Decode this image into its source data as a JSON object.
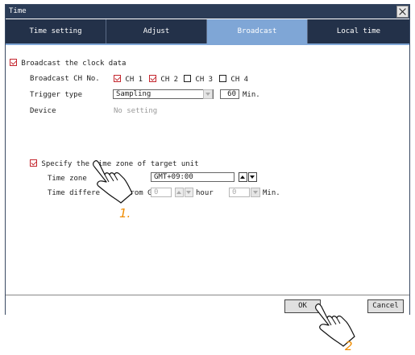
{
  "window": {
    "title": "Time"
  },
  "tabs": [
    {
      "label": "Time setting"
    },
    {
      "label": "Adjust"
    },
    {
      "label": "Broadcast"
    },
    {
      "label": "Local time"
    }
  ],
  "broadcast": {
    "checkbox_label": "Broadcast the clock data",
    "checked": true,
    "ch_label": "Broadcast CH No.",
    "channels": [
      {
        "label": "CH 1",
        "checked": true
      },
      {
        "label": "CH 2",
        "checked": true
      },
      {
        "label": "CH 3",
        "checked": false
      },
      {
        "label": "CH 4",
        "checked": false
      }
    ],
    "trigger_label": "Trigger type",
    "trigger_value": "Sampling",
    "trigger_interval": "60",
    "trigger_unit": "Min.",
    "device_label": "Device",
    "device_value": "No setting"
  },
  "timezone": {
    "checkbox_label": "Specify the time zone of target unit",
    "checked": true,
    "zone_label": "Time zone",
    "zone_value": "GMT+09:00",
    "diff_label_part1": "Time differe",
    "diff_label_part2": "from GMT",
    "hour_value": "0",
    "hour_unit": "hour",
    "min_value": "0",
    "min_unit": "Min."
  },
  "footer": {
    "ok_label": "OK",
    "cancel_label": "Cancel"
  },
  "annotations": {
    "step1": "1.",
    "step2": "2"
  },
  "colors": {
    "titlebar": "#2b3c57",
    "tab": "#233149",
    "tab_active": "#7fa6d6",
    "checkbox": "#c4262e",
    "step": "#f08c00"
  }
}
